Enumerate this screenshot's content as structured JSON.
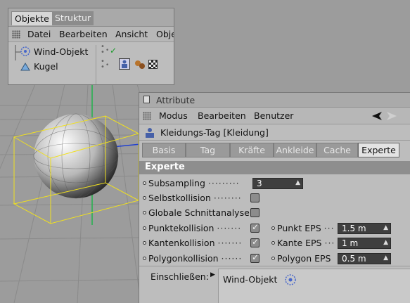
{
  "object_manager": {
    "tabs": [
      {
        "label": "Objekte",
        "active": true
      },
      {
        "label": "Struktur",
        "active": false
      }
    ],
    "menu": [
      "Datei",
      "Bearbeiten",
      "Ansicht",
      "Obje"
    ],
    "objects": [
      {
        "name": "Wind-Objekt",
        "icon": "wind-object-icon"
      },
      {
        "name": "Kugel",
        "icon": "sphere-object-icon"
      }
    ]
  },
  "attributes": {
    "panel_title": "Attribute",
    "menu": [
      "Modus",
      "Bearbeiten",
      "Benutzer"
    ],
    "tag_title": "Kleidungs-Tag [Kleidung]",
    "tabs": [
      {
        "label": "Basis",
        "active": false
      },
      {
        "label": "Tag",
        "active": false
      },
      {
        "label": "Kräfte",
        "active": false
      },
      {
        "label": "Ankleide",
        "active": false
      },
      {
        "label": "Cache",
        "active": false
      },
      {
        "label": "Experte",
        "active": true
      }
    ],
    "section": "Experte",
    "subsampling": {
      "label": "Subsampling",
      "value": "3"
    },
    "selbstkollision": {
      "label": "Selbstkollision",
      "checked": false
    },
    "globale": {
      "label": "Globale Schnittanalyse",
      "checked": false
    },
    "punktkollision": {
      "label": "Punktekollision",
      "checked": true,
      "eps_label": "Punkt EPS",
      "eps_value": "1.5 m"
    },
    "kantenkollision": {
      "label": "Kantenkollision",
      "checked": true,
      "eps_label": "Kante EPS",
      "eps_value": "1 m"
    },
    "polygonkollision": {
      "label": "Polygonkollision",
      "checked": true,
      "eps_label": "Polygon EPS",
      "eps_value": "0.5 m"
    },
    "include": {
      "label": "Einschließen:",
      "item": "Wind-Objekt"
    }
  },
  "colors": {
    "panel_bg": "#bdbdbd",
    "field_bg": "#3f3f3f",
    "viewport_bg": "#9a9a9a",
    "bbox_yellow": "#f0e020"
  }
}
